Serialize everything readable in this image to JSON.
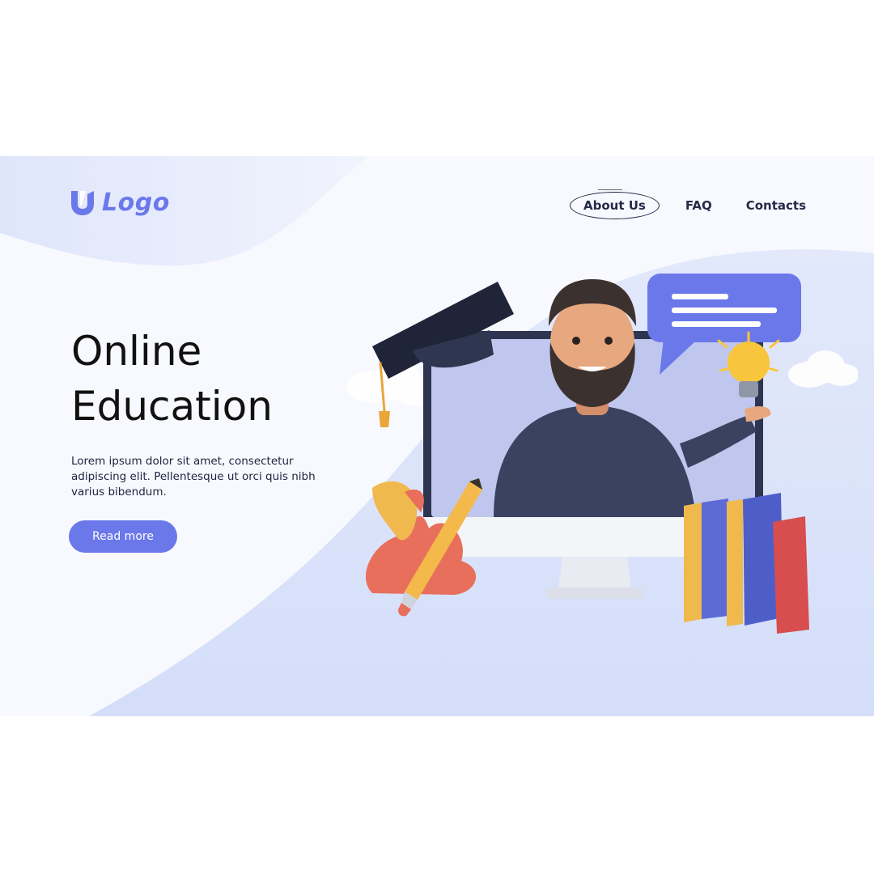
{
  "brand": {
    "logo_text": "Logo",
    "accent_color": "#6b78ea",
    "logo_icon": "u-shape-logo-icon"
  },
  "nav": {
    "items": [
      {
        "label": "About Us",
        "active": true
      },
      {
        "label": "FAQ",
        "active": false
      },
      {
        "label": "Contacts",
        "active": false
      }
    ]
  },
  "hero": {
    "title_line1": "Online",
    "title_line2": "Education",
    "description": "Lorem ipsum dolor sit amet, consectetur adipiscing elit. Pellentesque ut orci quis nibh varius bibendum.",
    "cta_label": "Read more"
  },
  "illustration": {
    "subject": "teacher-on-monitor-illustration",
    "elements": [
      "graduation-cap-icon",
      "speech-bubble-icon",
      "lightbulb-icon",
      "pencil-icon",
      "books-icon",
      "cloud-icon",
      "plant-icon"
    ]
  }
}
